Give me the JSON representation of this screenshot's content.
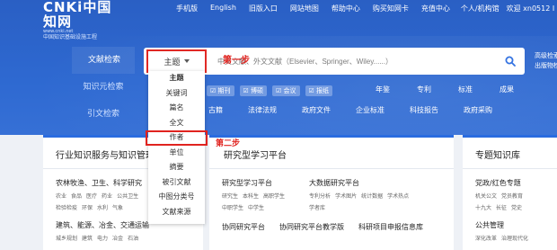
{
  "logo": {
    "main": "CNKi中国知网",
    "url": "www.cnki.net",
    "sub": "中国知识基础设施工程"
  },
  "topnav": [
    "手机版",
    "English",
    "旧版入口",
    "网站地图",
    "帮助中心",
    "购买知网卡",
    "充值中心",
    "个人/机构馆",
    "欢迎 xn0512 I 深圳职业技术学..."
  ],
  "side_tabs": [
    "文献检索",
    "知识元检索",
    "引文检索"
  ],
  "search": {
    "field": "主题",
    "placeholder": "中文文献、外文文献（Elsevier、Springer、Wiley......）",
    "advanced": [
      "高级检索",
      "出版物检索"
    ]
  },
  "annotations": {
    "step1": "第一步",
    "step2": "第二步"
  },
  "resource_checks": [
    "期刊",
    "博硕",
    "会议",
    "报纸"
  ],
  "categories": [
    "年鉴",
    "专利",
    "标准",
    "成果"
  ],
  "subjects": [
    "古籍",
    "法律法规",
    "政府文件",
    "企业标准",
    "科技报告",
    "政府采购"
  ],
  "dropdown": [
    "主题",
    "关键词",
    "篇名",
    "全文",
    "作者",
    "单位",
    "摘要",
    "被引文献",
    "中图分类号",
    "文献来源"
  ],
  "card1": {
    "title": "行业知识服务与知识管理平台",
    "s1": {
      "title": "农林牧渔、卫生、科学研究",
      "tags1": [
        "农业",
        "食品",
        "医疗",
        "药业",
        "公共卫生"
      ],
      "tags2": [
        "检验检疫",
        "环保",
        "水利",
        "气象"
      ]
    },
    "s2": {
      "title": "建筑、能源、冶金、交通运输",
      "tags1": [
        "城乡规划",
        "建筑",
        "电力",
        "冶金",
        "石油"
      ]
    }
  },
  "card2": {
    "title": "研究型学习平台",
    "left": {
      "title": "研究型学习平台",
      "tags1": [
        "研究生",
        "本科生",
        "高职学生"
      ],
      "tags2": [
        "中职学生",
        "中学生"
      ]
    },
    "right": {
      "title": "大数据研究平台",
      "tags1": [
        "专利分析",
        "学术图片",
        "统计数据",
        "学术热点"
      ],
      "tags2": [
        "学者库"
      ]
    },
    "row3": [
      "协同研究平台",
      "协同研究平台教学版",
      "科研项目申报信息库"
    ]
  },
  "card3": {
    "title": "专题知识库",
    "s1": {
      "title": "党政/红色专题",
      "tags1": [
        "机关公文",
        "党员教育"
      ],
      "tags2": [
        "十九大",
        "长征",
        "党史"
      ]
    },
    "s2": {
      "title": "公共管理",
      "tags1": [
        "深化改革",
        "治理现代化"
      ]
    }
  },
  "colors": {
    "header": "#2e69d1",
    "highlight": "#e0231f",
    "accent": "#2a6ce0"
  }
}
